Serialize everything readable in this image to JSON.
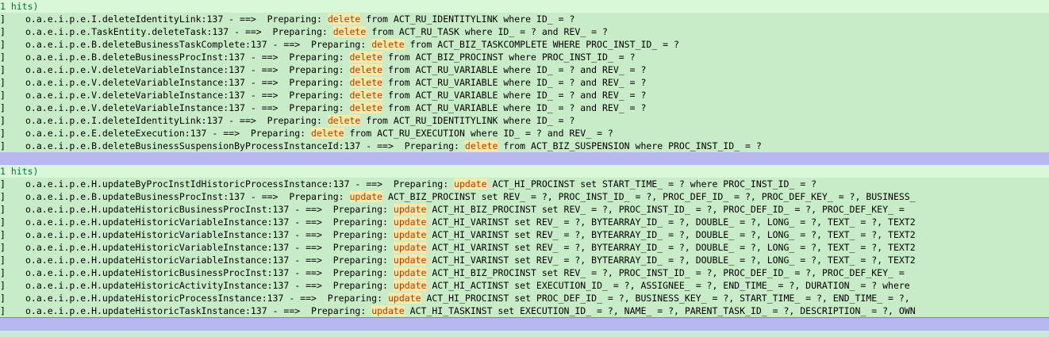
{
  "block1": {
    "hits": "1 hits)",
    "rows": [
      {
        "bracket": "]",
        "left": "o.a.e.i.p.e.I.deleteIdentityLink:137 - ==>  Preparing: ",
        "kw": "delete",
        "rest": " from ACT_RU_IDENTITYLINK where ID_ = ?"
      },
      {
        "bracket": "]",
        "left": "o.a.e.i.p.e.TaskEntity.deleteTask:137 - ==>  Preparing: ",
        "kw": "delete",
        "rest": " from ACT_RU_TASK where ID_ = ? and REV_ = ?"
      },
      {
        "bracket": "]",
        "left": "o.a.e.i.p.e.B.deleteBusinessTaskComplete:137 - ==>  Preparing: ",
        "kw": "delete",
        "rest": " from ACT_BIZ_TASKCOMPLETE WHERE PROC_INST_ID_ = ?"
      },
      {
        "bracket": "]",
        "left": "o.a.e.i.p.e.B.deleteBusinessProcInst:137 - ==>  Preparing: ",
        "kw": "delete",
        "rest": " from ACT_BIZ_PROCINST where PROC_INST_ID_ = ?"
      },
      {
        "bracket": "]",
        "left": "o.a.e.i.p.e.V.deleteVariableInstance:137 - ==>  Preparing: ",
        "kw": "delete",
        "rest": " from ACT_RU_VARIABLE where ID_ = ? and REV_ = ?"
      },
      {
        "bracket": "]",
        "left": "o.a.e.i.p.e.V.deleteVariableInstance:137 - ==>  Preparing: ",
        "kw": "delete",
        "rest": " from ACT_RU_VARIABLE where ID_ = ? and REV_ = ?"
      },
      {
        "bracket": "]",
        "left": "o.a.e.i.p.e.V.deleteVariableInstance:137 - ==>  Preparing: ",
        "kw": "delete",
        "rest": " from ACT_RU_VARIABLE where ID_ = ? and REV_ = ?"
      },
      {
        "bracket": "]",
        "left": "o.a.e.i.p.e.V.deleteVariableInstance:137 - ==>  Preparing: ",
        "kw": "delete",
        "rest": " from ACT_RU_VARIABLE where ID_ = ? and REV_ = ?"
      },
      {
        "bracket": "]",
        "left": "o.a.e.i.p.e.I.deleteIdentityLink:137 - ==>  Preparing: ",
        "kw": "delete",
        "rest": " from ACT_RU_IDENTITYLINK where ID_ = ?"
      },
      {
        "bracket": "]",
        "left": "o.a.e.i.p.e.E.deleteExecution:137 - ==>  Preparing: ",
        "kw": "delete",
        "rest": " from ACT_RU_EXECUTION where ID_ = ? and REV_ = ?"
      },
      {
        "bracket": "]",
        "left": "o.a.e.i.p.e.B.deleteBusinessSuspensionByProcessInstanceId:137 - ==>  Preparing: ",
        "kw": "delete",
        "rest": " from ACT_BIZ_SUSPENSION where PROC_INST_ID_ = ?"
      }
    ]
  },
  "block2": {
    "hits": "1 hits)",
    "rows": [
      {
        "bracket": "]",
        "left": "o.a.e.i.p.e.H.updateByProcInstIdHistoricProcessInstance:137 - ==>  Preparing: ",
        "kw": "update",
        "rest": " ACT_HI_PROCINST set START_TIME_ = ? where PROC_INST_ID_ = ?"
      },
      {
        "bracket": "]",
        "left": "o.a.e.i.p.e.B.updateBusinessProcInst:137 - ==>  Preparing: ",
        "kw": "update",
        "rest": " ACT_BIZ_PROCINST set REV_ = ?, PROC_INST_ID_ = ?, PROC_DEF_ID_ = ?, PROC_DEF_KEY_ = ?, BUSINESS_"
      },
      {
        "bracket": "]",
        "left": "o.a.e.i.p.e.H.updateHistoricBusinessProcInst:137 - ==>  Preparing: ",
        "kw": "update",
        "rest": " ACT_HI_BIZ_PROCINST set REV_ = ?, PROC_INST_ID_ = ?, PROC_DEF_ID_ = ?, PROC_DEF_KEY_ = "
      },
      {
        "bracket": "]",
        "left": "o.a.e.i.p.e.H.updateHistoricVariableInstance:137 - ==>  Preparing: ",
        "kw": "update",
        "rest": " ACT_HI_VARINST set REV_ = ?, BYTEARRAY_ID_ = ?, DOUBLE_ = ?, LONG_ = ?, TEXT_ = ?, TEXT2"
      },
      {
        "bracket": "]",
        "left": "o.a.e.i.p.e.H.updateHistoricVariableInstance:137 - ==>  Preparing: ",
        "kw": "update",
        "rest": " ACT_HI_VARINST set REV_ = ?, BYTEARRAY_ID_ = ?, DOUBLE_ = ?, LONG_ = ?, TEXT_ = ?, TEXT2"
      },
      {
        "bracket": "]",
        "left": "o.a.e.i.p.e.H.updateHistoricVariableInstance:137 - ==>  Preparing: ",
        "kw": "update",
        "rest": " ACT_HI_VARINST set REV_ = ?, BYTEARRAY_ID_ = ?, DOUBLE_ = ?, LONG_ = ?, TEXT_ = ?, TEXT2"
      },
      {
        "bracket": "]",
        "left": "o.a.e.i.p.e.H.updateHistoricVariableInstance:137 - ==>  Preparing: ",
        "kw": "update",
        "rest": " ACT_HI_VARINST set REV_ = ?, BYTEARRAY_ID_ = ?, DOUBLE_ = ?, LONG_ = ?, TEXT_ = ?, TEXT2"
      },
      {
        "bracket": "]",
        "left": "o.a.e.i.p.e.H.updateHistoricBusinessProcInst:137 - ==>  Preparing: ",
        "kw": "update",
        "rest": " ACT_HI_BIZ_PROCINST set REV_ = ?, PROC_INST_ID_ = ?, PROC_DEF_ID_ = ?, PROC_DEF_KEY_ = "
      },
      {
        "bracket": "]",
        "left": "o.a.e.i.p.e.H.updateHistoricActivityInstance:137 - ==>  Preparing: ",
        "kw": "update",
        "rest": " ACT_HI_ACTINST set EXECUTION_ID_ = ?, ASSIGNEE_ = ?, END_TIME_ = ?, DURATION_ = ? where"
      },
      {
        "bracket": "]",
        "left": "o.a.e.i.p.e.H.updateHistoricProcessInstance:137 - ==>  Preparing: ",
        "kw": "update",
        "rest": " ACT_HI_PROCINST set PROC_DEF_ID_ = ?, BUSINESS_KEY_ = ?, START_TIME_ = ?, END_TIME_ = ?,"
      },
      {
        "bracket": "]",
        "left": "o.a.e.i.p.e.H.updateHistoricTaskInstance:137 - ==>  Preparing: ",
        "kw": "update",
        "rest": " ACT_HI_TASKINST set EXECUTION_ID_ = ?, NAME_ = ?, PARENT_TASK_ID_ = ?, DESCRIPTION_ = ?, OWN"
      }
    ]
  },
  "colors": {
    "background": "#c8ecd0",
    "hits_text": "#007a30",
    "keyword_bg": "#ffe9a8",
    "keyword_text": "#b23800",
    "separator": "#b8b8f0"
  }
}
